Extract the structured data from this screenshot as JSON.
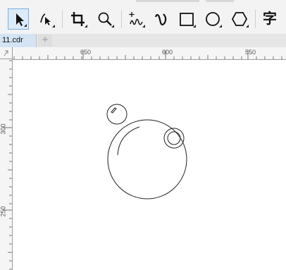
{
  "toolbar": {
    "tools": [
      {
        "name": "pick-tool",
        "icon": "arrow-pointer-icon",
        "active": true
      },
      {
        "name": "shape-tool",
        "icon": "node-edit-icon",
        "active": false
      },
      {
        "name": "crop-tool",
        "icon": "crop-icon",
        "active": false
      },
      {
        "name": "zoom-tool",
        "icon": "magnifier-icon",
        "active": false
      },
      {
        "name": "freehand-tool",
        "icon": "freehand-icon",
        "active": false
      },
      {
        "name": "artistic-media-tool",
        "icon": "artistic-media-icon",
        "active": false
      },
      {
        "name": "rectangle-tool",
        "icon": "rectangle-icon",
        "active": false
      },
      {
        "name": "ellipse-tool",
        "icon": "ellipse-icon",
        "active": false
      },
      {
        "name": "polygon-tool",
        "icon": "polygon-icon",
        "active": false
      },
      {
        "name": "text-tool",
        "icon": "text-glyph-icon",
        "active": false
      }
    ],
    "text_tool_glyph": "字"
  },
  "tabs": {
    "document": "11.cdr",
    "add": "+"
  },
  "rulers": {
    "horizontal": [
      "650",
      "600",
      "550"
    ],
    "vertical": [
      "300",
      "250"
    ]
  }
}
